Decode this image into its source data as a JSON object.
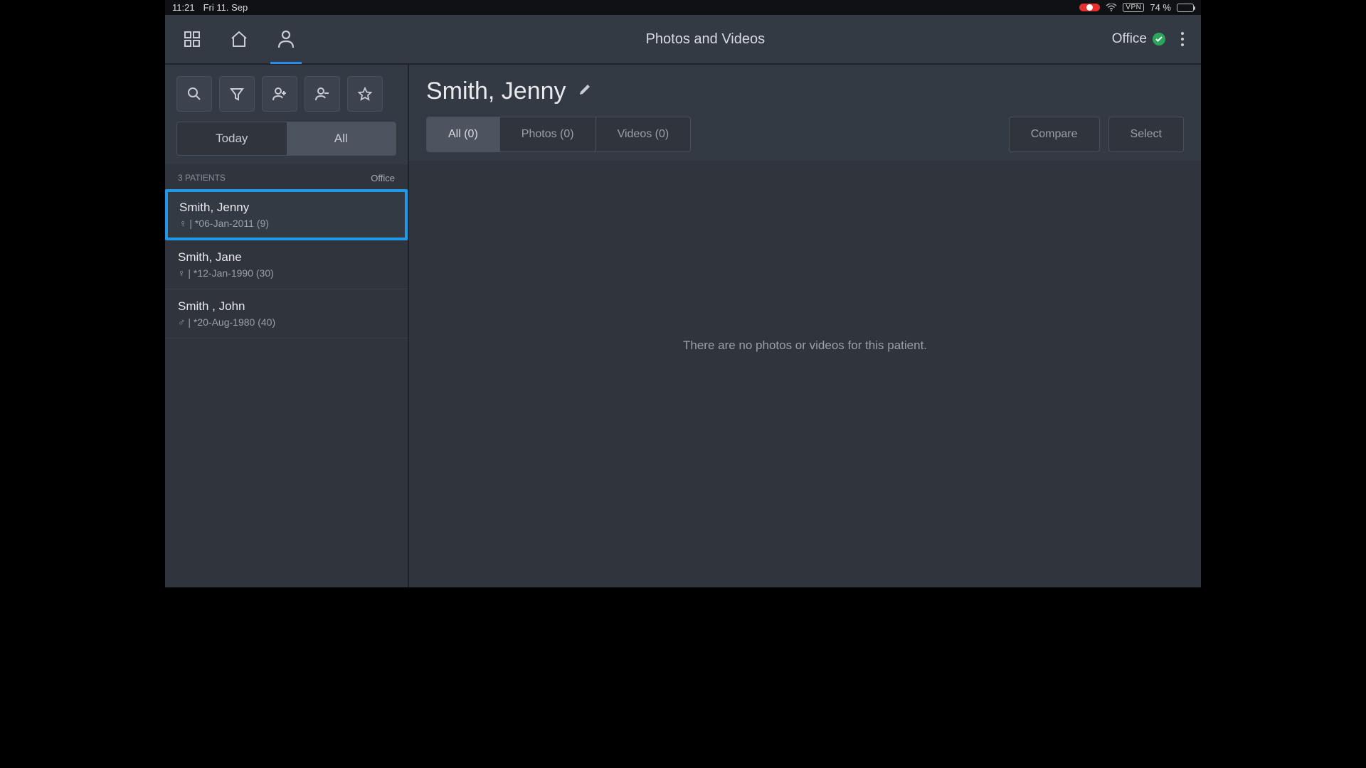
{
  "status": {
    "time": "11:21",
    "date": "Fri 11. Sep",
    "vpn": "VPN",
    "battery_pct": "74 %"
  },
  "header": {
    "title": "Photos and Videos",
    "account_label": "Office"
  },
  "sidebar": {
    "segments": {
      "today": "Today",
      "all": "All"
    },
    "list_header": {
      "count": "3 PATIENTS",
      "location": "Office"
    },
    "patients": [
      {
        "name": "Smith, Jenny",
        "gender": "♀",
        "meta": "*06-Jan-2011 (9)",
        "selected": true
      },
      {
        "name": "Smith, Jane",
        "gender": "♀",
        "meta": "*12-Jan-1990 (30)",
        "selected": false
      },
      {
        "name": "Smith , John",
        "gender": "♂",
        "meta": "*20-Aug-1980 (40)",
        "selected": false
      }
    ]
  },
  "content": {
    "patient_title": "Smith, Jenny",
    "tabs": {
      "all": "All (0)",
      "photos": "Photos (0)",
      "videos": "Videos (0)"
    },
    "actions": {
      "compare": "Compare",
      "select": "Select"
    },
    "empty": "There are no photos or videos for this patient."
  }
}
